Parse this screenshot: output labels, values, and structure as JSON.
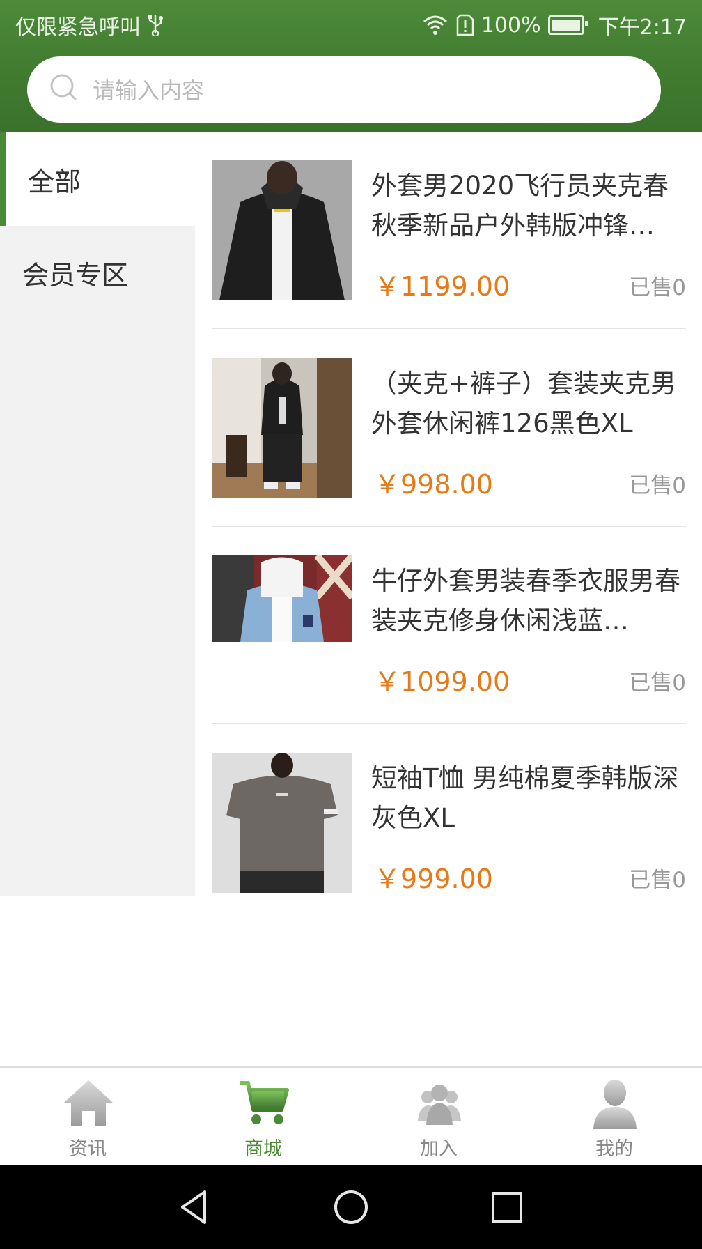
{
  "status_bar": {
    "left_text": "仅限紧急呼叫",
    "battery": "100%",
    "time": "下午2:17"
  },
  "search": {
    "placeholder": "请输入内容"
  },
  "sidebar": {
    "items": [
      {
        "label": "全部",
        "active": true
      },
      {
        "label": "会员专区",
        "active": false
      }
    ]
  },
  "products": [
    {
      "title": "外套男2020飞行员夹克春秋季新品户外韩版冲锋…",
      "price": "￥1199.00",
      "sold": "已售0"
    },
    {
      "title": "（夹克+裤子）套装夹克男外套休闲裤126黑色XL",
      "price": "￥998.00",
      "sold": "已售0"
    },
    {
      "title": "牛仔外套男装春季衣服男春装夹克修身休闲浅蓝…",
      "price": "￥1099.00",
      "sold": "已售0"
    },
    {
      "title": "短袖T恤 男纯棉夏季韩版深灰色XL",
      "price": "￥999.00",
      "sold": "已售0"
    }
  ],
  "bottom_nav": {
    "items": [
      {
        "label": "资讯",
        "icon": "home-icon"
      },
      {
        "label": "商城",
        "icon": "cart-icon",
        "active": true
      },
      {
        "label": "加入",
        "icon": "group-icon"
      },
      {
        "label": "我的",
        "icon": "user-icon"
      }
    ]
  },
  "colors": {
    "brand_green": "#4a8a34",
    "price_orange": "#e87a16"
  }
}
